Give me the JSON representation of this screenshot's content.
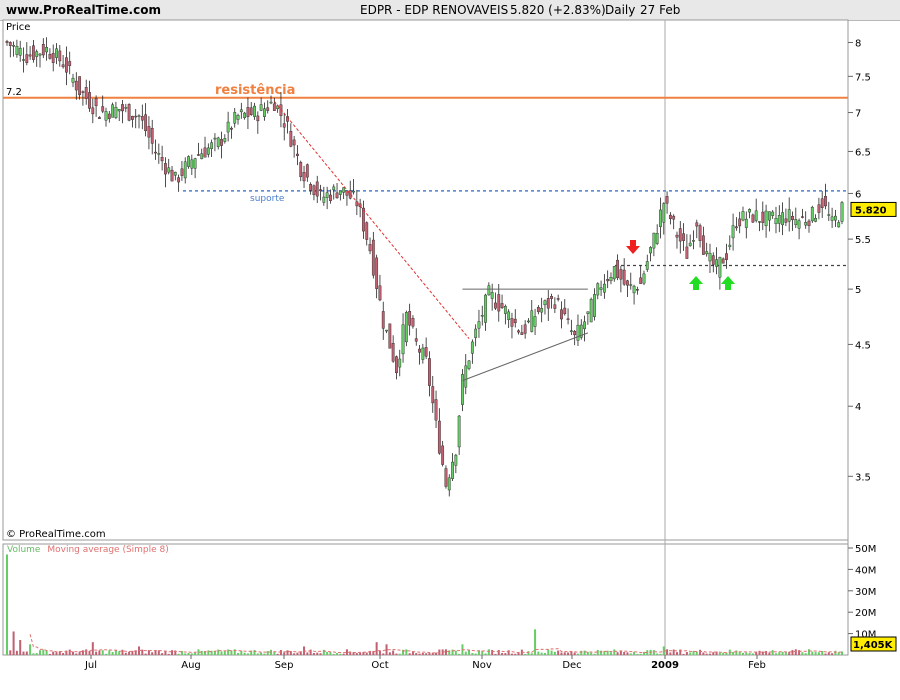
{
  "header": {
    "site": "www.ProRealTime.com",
    "symbol": "EDPR - EDP RENOVAVEIS",
    "price_change": "5.820 (+2.83%)",
    "period": "Daily",
    "date": "27 Feb"
  },
  "watermark": "© ProRealTime.com",
  "chart_data": [
    {
      "type": "candlestick",
      "ylabel": "Price",
      "ylim": [
        3.1,
        8.35
      ],
      "scale": "log",
      "y_ticks": [
        "8",
        "7.5",
        "7",
        "6.5",
        "6",
        "5.5",
        "5",
        "4.5",
        "4",
        "3.5"
      ],
      "x_labels": [
        "Jul",
        "Aug",
        "Sep",
        "Oct",
        "Nov",
        "Dec",
        "2009",
        "Feb"
      ],
      "last_price_label": "5.820",
      "annotations": {
        "resistance_label": "resistência",
        "resistance_value_label": "7.2",
        "resistance": 7.2,
        "support_label": "suporte",
        "support": 6.03,
        "breakout_level": 5.23
      },
      "series_keyframes": [
        {
          "i": 0,
          "v": 8.0
        },
        {
          "i": 6,
          "v": 7.8
        },
        {
          "i": 12,
          "v": 7.9
        },
        {
          "i": 17,
          "v": 7.7
        },
        {
          "i": 22,
          "v": 7.3
        },
        {
          "i": 28,
          "v": 7.0
        },
        {
          "i": 34,
          "v": 7.05
        },
        {
          "i": 40,
          "v": 6.95
        },
        {
          "i": 45,
          "v": 6.5
        },
        {
          "i": 51,
          "v": 6.15
        },
        {
          "i": 57,
          "v": 6.45
        },
        {
          "i": 64,
          "v": 6.6
        },
        {
          "i": 70,
          "v": 6.95
        },
        {
          "i": 76,
          "v": 7.0
        },
        {
          "i": 81,
          "v": 7.15
        },
        {
          "i": 85,
          "v": 6.8
        },
        {
          "i": 89,
          "v": 6.3
        },
        {
          "i": 95,
          "v": 5.95
        },
        {
          "i": 101,
          "v": 6.05
        },
        {
          "i": 106,
          "v": 5.9
        },
        {
          "i": 110,
          "v": 5.4
        },
        {
          "i": 114,
          "v": 4.7
        },
        {
          "i": 118,
          "v": 4.3
        },
        {
          "i": 121,
          "v": 4.75
        },
        {
          "i": 124,
          "v": 4.5
        },
        {
          "i": 127,
          "v": 4.35
        },
        {
          "i": 130,
          "v": 3.85
        },
        {
          "i": 133,
          "v": 3.45
        },
        {
          "i": 136,
          "v": 3.7
        },
        {
          "i": 138,
          "v": 4.2
        },
        {
          "i": 142,
          "v": 4.6
        },
        {
          "i": 146,
          "v": 4.95
        },
        {
          "i": 151,
          "v": 4.8
        },
        {
          "i": 156,
          "v": 4.6
        },
        {
          "i": 161,
          "v": 4.8
        },
        {
          "i": 166,
          "v": 4.9
        },
        {
          "i": 172,
          "v": 4.55
        },
        {
          "i": 176,
          "v": 4.75
        },
        {
          "i": 180,
          "v": 5.05
        },
        {
          "i": 184,
          "v": 5.2
        },
        {
          "i": 188,
          "v": 5.0
        },
        {
          "i": 192,
          "v": 5.05
        },
        {
          "i": 196,
          "v": 5.5
        },
        {
          "i": 199,
          "v": 5.9
        },
        {
          "i": 203,
          "v": 5.55
        },
        {
          "i": 206,
          "v": 5.35
        },
        {
          "i": 209,
          "v": 5.7
        },
        {
          "i": 212,
          "v": 5.3
        },
        {
          "i": 215,
          "v": 5.2
        },
        {
          "i": 218,
          "v": 5.35
        },
        {
          "i": 221,
          "v": 5.7
        },
        {
          "i": 226,
          "v": 5.75
        },
        {
          "i": 231,
          "v": 5.7
        },
        {
          "i": 236,
          "v": 5.75
        },
        {
          "i": 240,
          "v": 5.7
        },
        {
          "i": 244,
          "v": 5.75
        },
        {
          "i": 247,
          "v": 5.9
        },
        {
          "i": 250,
          "v": 5.65
        },
        {
          "i": 253,
          "v": 5.82
        }
      ]
    },
    {
      "type": "bar",
      "title": "Volume",
      "subtitle": "Moving average (Simple 8)",
      "y_ticks": [
        "50M",
        "40M",
        "30M",
        "20M",
        "10M"
      ],
      "ylim": [
        0,
        50
      ],
      "unit": "M",
      "last_volume_label": "1,405K",
      "spikes": [
        {
          "i": 0,
          "v": 47
        },
        {
          "i": 2,
          "v": 11
        },
        {
          "i": 4,
          "v": 7
        },
        {
          "i": 7,
          "v": 5
        },
        {
          "i": 26,
          "v": 6
        },
        {
          "i": 40,
          "v": 4
        },
        {
          "i": 90,
          "v": 4
        },
        {
          "i": 112,
          "v": 6
        },
        {
          "i": 115,
          "v": 5
        },
        {
          "i": 138,
          "v": 5
        },
        {
          "i": 160,
          "v": 12
        },
        {
          "i": 199,
          "v": 4
        }
      ]
    }
  ],
  "colors": {
    "up": "#66cc66",
    "down": "#c06070",
    "resistance": "#f08040",
    "support": "#4a7fd0",
    "trend": "#e03030",
    "arrow_down": "#ee2020",
    "arrow_up": "#22dd22",
    "volume_title": "#e07070",
    "last_price_bg": "#ffee00"
  }
}
